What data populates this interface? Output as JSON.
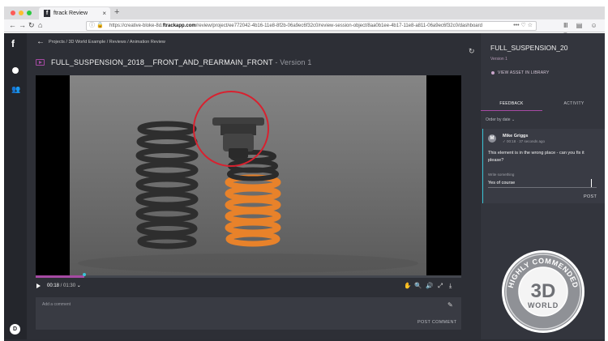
{
  "browser": {
    "tab_title": "ftrack Review",
    "url_host_prefix": "https://creative-bloke-8d.",
    "url_host": "ftrackapp.com",
    "url_path": "/review/project/ee772042-4b16-11e8-8f2b-06a9ec6f32c0/review-session-object/8aa0b1ee-4b17-11e8-a811-06a9ec6f32c0/dashboard",
    "page_actions": "••• ♡ ☆",
    "toolbar_icons": "Ⅲ ▤ ☺ ≡"
  },
  "app": {
    "brand": "f",
    "user_initial": "D"
  },
  "breadcrumb": "Projects / 3D World Example / Reviews / Animation Review",
  "asset": {
    "title": "FULL_SUSPENSION_2018__FRONT_AND_REARMAIN_FRONT",
    "version": " - Version 1"
  },
  "player": {
    "current_time": "00:18",
    "total_time": " / 01:30",
    "progress": 0.115
  },
  "comment": {
    "placeholder": "Add a comment",
    "post_label": "POST COMMENT"
  },
  "review": {
    "title": "FULL_SUSPENSION_20",
    "version": "Version 1",
    "view_library_label": "VIEW ASSET IN LIBRARY",
    "tabs": {
      "feedback": "FEEDBACK",
      "activity": "ACTIVITY"
    },
    "order_label": "Order by date ⌄"
  },
  "feedback": {
    "author_initial": "M",
    "author": "Mike Griggs",
    "time": "✓ 00:18 · 37 seconds ago",
    "message": "This element is in the wrong place - can you fix it please?",
    "reply_label": "Write something",
    "reply_value": "Yes of course",
    "post_label": "POST"
  },
  "colors": {
    "accent": "#a64aa3",
    "highlight": "#3bc4d6",
    "annotation": "#d8212f",
    "spring_dark": "#2e2e2e",
    "spring_orange": "#e8822a"
  },
  "badge": {
    "top_text": "HIGHLY COMMENDED",
    "big_text": "3D",
    "sub_text": "WORLD"
  }
}
